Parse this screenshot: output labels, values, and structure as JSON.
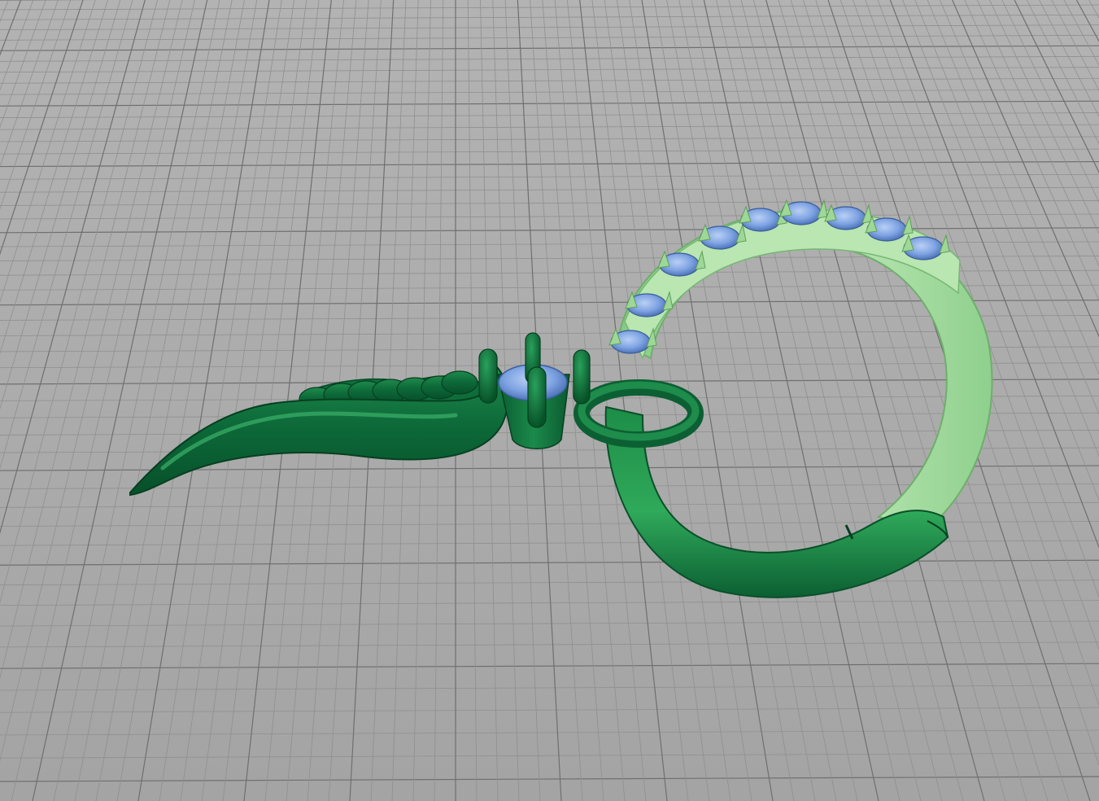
{
  "viewport": {
    "view": "perspective",
    "grid": true,
    "colors": {
      "background": "#a9a9a9",
      "grid_minor": "#8f8f8f",
      "grid_major": "#6f6f6f",
      "metal_dark": "#0f6a3a",
      "metal_light": "#a8dba0",
      "gem": "#7ea6e6"
    }
  },
  "model": {
    "name": "",
    "parts": [
      "wing-pendant",
      "prong-setting",
      "center-gem",
      "jump-ring",
      "hoop",
      "hinge-section",
      "pave-gems"
    ]
  }
}
